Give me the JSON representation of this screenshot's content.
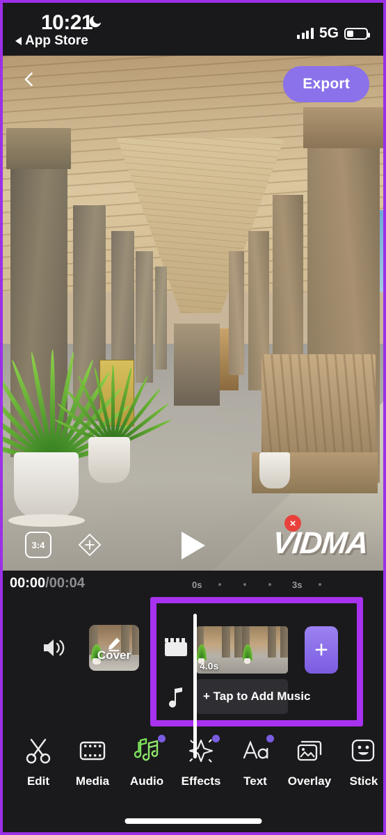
{
  "status_bar": {
    "time": "10:21",
    "moon_icon": "moon-icon",
    "back_app": "App Store",
    "network": "5G",
    "signal_icon": "signal-bars-icon",
    "battery_icon": "battery-low-icon"
  },
  "preview": {
    "back_icon": "chevron-left-icon",
    "export_label": "Export",
    "aspect_ratio": "3:4",
    "crop_icon": "crop-diamond-icon",
    "play_icon": "play-icon",
    "watermark": "VIDMA",
    "watermark_close": "×"
  },
  "timeline": {
    "current_time": "00:00",
    "total_time": "/00:04",
    "ruler": [
      "0s",
      "·",
      "·",
      "·",
      "3s",
      "·"
    ],
    "speaker_icon": "speaker-volume-icon",
    "cover": {
      "label": "Cover",
      "edit_icon": "pencil-icon"
    },
    "video_track_icon": "film-clapper-icon",
    "audio_track_icon": "music-note-icon",
    "clip_duration": "4.0s",
    "add_music_label": "+ Tap to Add Music",
    "add_button_label": "+"
  },
  "toolbar": {
    "items": [
      {
        "label": "Edit",
        "icon": "scissors-icon",
        "badge": false
      },
      {
        "label": "Media",
        "icon": "film-strip-icon",
        "badge": false
      },
      {
        "label": "Audio",
        "icon": "music-notes-icon",
        "badge": true
      },
      {
        "label": "Effects",
        "icon": "sparkle-star-icon",
        "badge": true
      },
      {
        "label": "Text",
        "icon": "text-aa-icon",
        "badge": true
      },
      {
        "label": "Overlay",
        "icon": "overlay-image-icon",
        "badge": false
      },
      {
        "label": "Stick",
        "icon": "sticker-smiley-icon",
        "badge": false
      }
    ]
  },
  "colors": {
    "accent_purple": "#8B72EA",
    "annotation_purple": "#A832F0",
    "frame_purple": "#9B30E8",
    "close_red": "#E8413C",
    "audio_green": "#7BE05A"
  }
}
